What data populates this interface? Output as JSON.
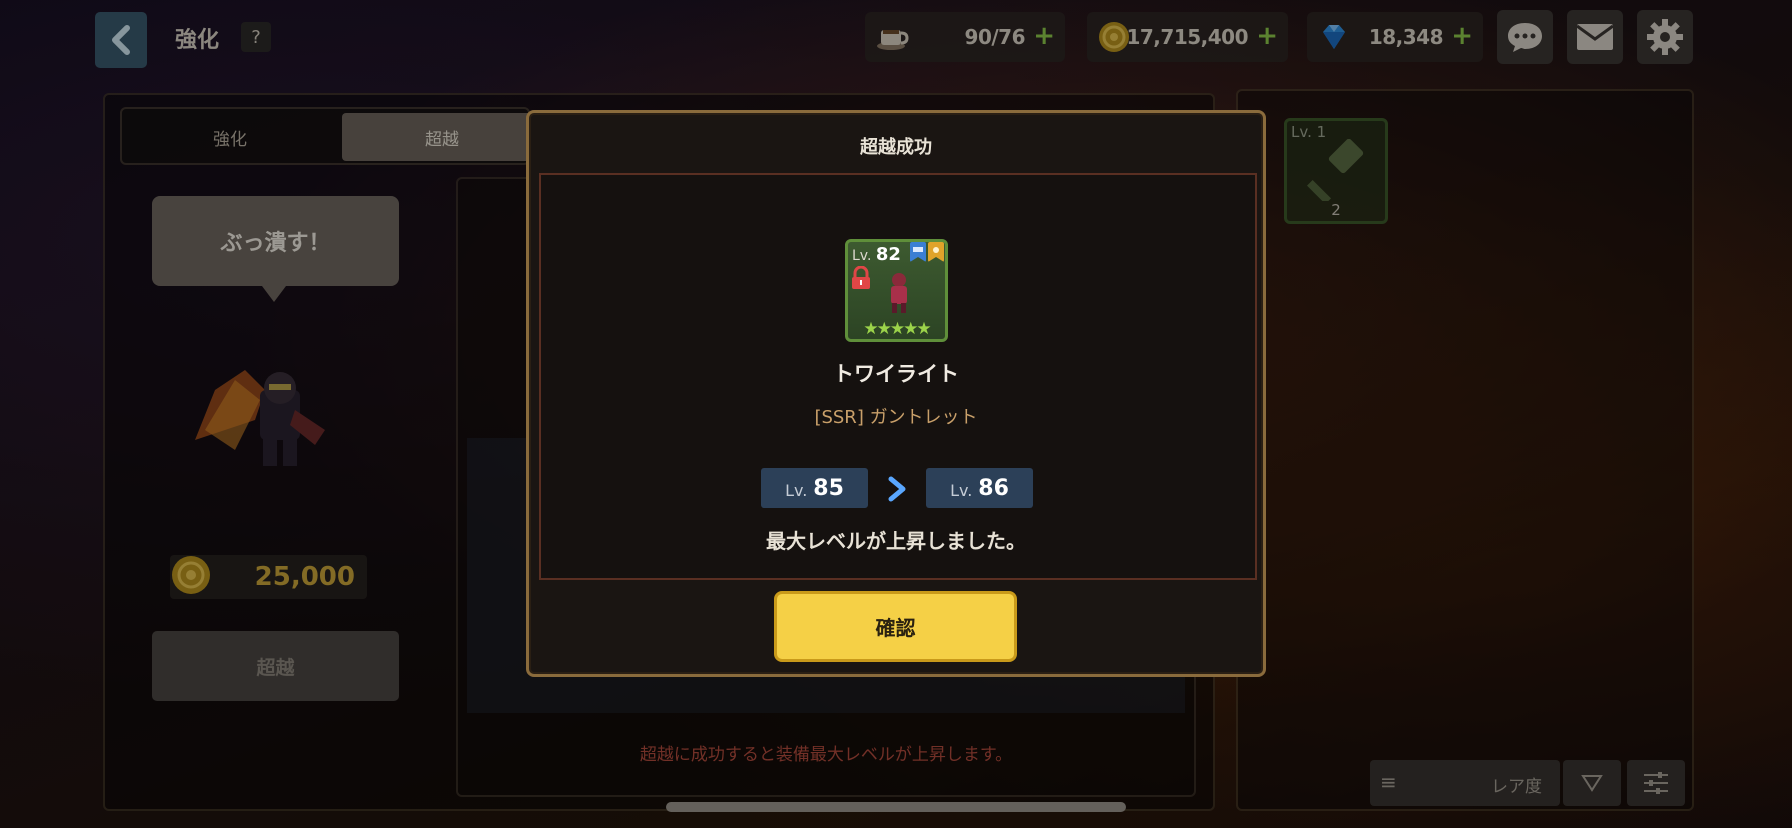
{
  "header": {
    "title": "強化",
    "help": "?",
    "resources": [
      {
        "name": "stamina",
        "icon": "coffee-cup-icon",
        "value": "90/76"
      },
      {
        "name": "gold",
        "icon": "coin-icon",
        "value": "17,715,400"
      },
      {
        "name": "gems",
        "icon": "diamond-icon",
        "value": "18,348"
      }
    ]
  },
  "tabs": {
    "enhance": "強化",
    "transcend": "超越"
  },
  "left": {
    "speech": "ぶっ潰す！",
    "cost": "25,000",
    "transcend_button": "超越"
  },
  "center": {
    "hint": "超越に成功すると装備最大レベルが上昇します。"
  },
  "inventory": {
    "item_level": "Lv. 1",
    "item_count": "2"
  },
  "sort": {
    "label": "レア度"
  },
  "modal": {
    "title": "超越成功",
    "card_level_prefix": "Lv.",
    "card_level": "82",
    "stars": "★★★★★",
    "item_name": "トワイライト",
    "item_type": "[SSR] ガントレット",
    "from_prefix": "Lv.",
    "from_level": "85",
    "to_prefix": "Lv.",
    "to_level": "86",
    "message": "最大レベルが上昇しました。",
    "confirm": "確認"
  },
  "colors": {
    "accent": "#f5d046",
    "hint": "#b04a3c",
    "gold": "#c9a53a"
  }
}
